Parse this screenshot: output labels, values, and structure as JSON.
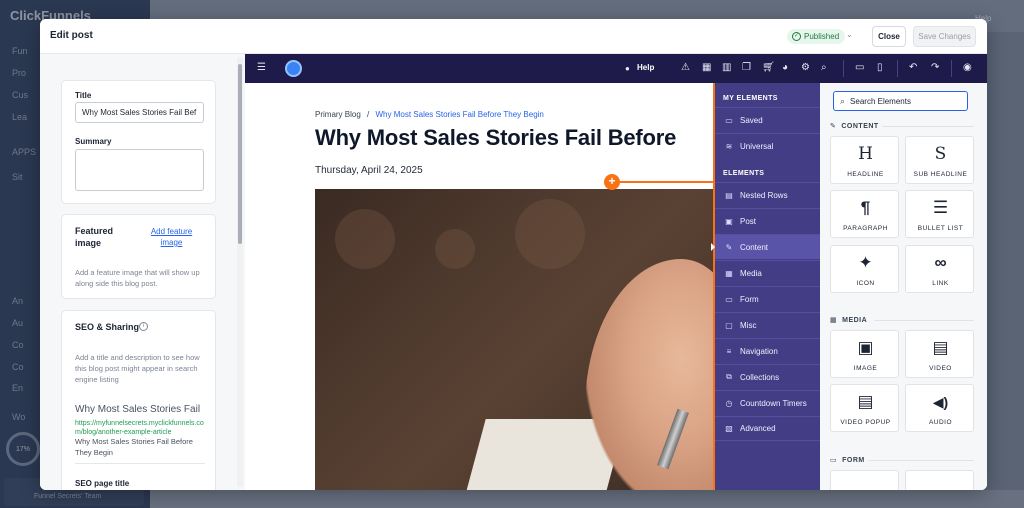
{
  "background": {
    "app_name": "ClickFunnels",
    "sidebar_items": [
      "Fun",
      "Pro",
      "Cus",
      "Lea"
    ],
    "section_apps": "APPS",
    "apps_item": "Sit",
    "lower_items": [
      "An",
      "Au",
      "Co",
      "Co",
      "En"
    ],
    "wor_item": "Wo",
    "progress": "17%",
    "team_label": "Funnel Secrets' Team",
    "help": "Help"
  },
  "modal": {
    "title": "Edit post",
    "status": "Published",
    "close_label": "Close",
    "save_label": "Save Changes"
  },
  "form": {
    "title_label": "Title",
    "title_value": "Why Most Sales Stories Fail Bef",
    "summary_label": "Summary",
    "featured_label": "Featured image",
    "add_featured_link": "Add feature image",
    "featured_help": "Add a feature image that will show up along side this blog post.",
    "seo_heading": "SEO & Sharing",
    "seo_help": "Add a title and description to see how this blog post might appear in search engine listing",
    "seo_preview_title": "Why Most Sales Stories Fail",
    "seo_preview_url": "https://myfunnelsecrets.myclickfunnels.com/blog/another-example-article",
    "seo_preview_desc": "Why Most Sales Stories Fail Before They Begin",
    "seo_page_title_label": "SEO page title"
  },
  "toolbar": {
    "help": "Help"
  },
  "canvas": {
    "breadcrumb_root": "Primary Blog",
    "breadcrumb_sep": "/",
    "breadcrumb_current": "Why Most Sales Stories Fail Before They Begin",
    "post_title": "Why Most Sales Stories Fail Before",
    "post_date": "Thursday, April 24, 2025"
  },
  "categories": {
    "my_elements_heading": "MY ELEMENTS",
    "my_elements": [
      {
        "label": "Saved",
        "icon": "bookmark-icon"
      },
      {
        "label": "Universal",
        "icon": "layers-icon"
      }
    ],
    "elements_heading": "ELEMENTS",
    "elements": [
      {
        "label": "Nested Rows",
        "icon": "rows-icon"
      },
      {
        "label": "Post",
        "icon": "post-icon"
      },
      {
        "label": "Content",
        "icon": "pen-icon"
      },
      {
        "label": "Media",
        "icon": "media-icon"
      },
      {
        "label": "Form",
        "icon": "form-icon"
      },
      {
        "label": "Misc",
        "icon": "misc-icon"
      },
      {
        "label": "Navigation",
        "icon": "navigation-icon"
      },
      {
        "label": "Collections",
        "icon": "collections-icon"
      },
      {
        "label": "Countdown Timers",
        "icon": "timer-icon"
      },
      {
        "label": "Advanced",
        "icon": "advanced-icon"
      }
    ]
  },
  "elements_panel": {
    "search_placeholder": "Search Elements",
    "content_heading": "CONTENT",
    "content_tiles": [
      {
        "label": "HEADLINE",
        "glyph": "H",
        "icon": "headline-icon"
      },
      {
        "label": "SUB HEADLINE",
        "glyph": "S",
        "icon": "sub-headline-icon"
      },
      {
        "label": "PARAGRAPH",
        "glyph": "¶",
        "icon": "paragraph-icon"
      },
      {
        "label": "BULLET LIST",
        "glyph": "☰",
        "icon": "bullet-list-icon"
      },
      {
        "label": "ICON",
        "glyph": "✦",
        "icon": "icon-icon"
      },
      {
        "label": "LINK",
        "glyph": "∞",
        "icon": "link-icon"
      }
    ],
    "media_heading": "MEDIA",
    "media_tiles": [
      {
        "label": "IMAGE",
        "glyph": "▣",
        "icon": "image-icon"
      },
      {
        "label": "VIDEO",
        "glyph": "▤",
        "icon": "video-icon"
      },
      {
        "label": "VIDEO POPUP",
        "glyph": "▤",
        "icon": "video-popup-icon"
      },
      {
        "label": "AUDIO",
        "glyph": "◀)",
        "icon": "audio-icon"
      }
    ],
    "form_heading": "FORM"
  }
}
